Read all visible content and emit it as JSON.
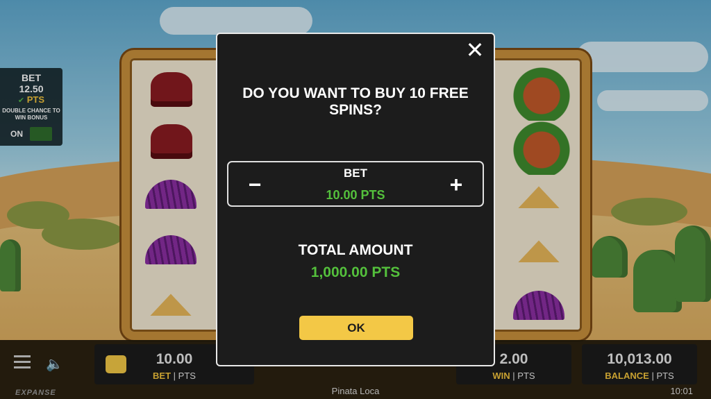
{
  "side_panel": {
    "bet_label": "BET",
    "bet_value": "12.50",
    "bet_unit": "PTS",
    "double_chance": "DOUBLE CHANCE TO WIN BONUS",
    "toggle_label": "ON"
  },
  "bottom_bar": {
    "bet_value": "10.00",
    "bet_label": "BET",
    "bet_unit": "PTS",
    "win_value": "2.00",
    "win_label": "WIN",
    "win_unit": "PTS",
    "balance_value": "10,013.00",
    "balance_label": "BALANCE",
    "balance_unit": "PTS",
    "game_name": "Pinata Loca",
    "clock": "10:01",
    "brand": "EXPANSE"
  },
  "modal": {
    "close_glyph": "✕",
    "question": "DO YOU WANT TO BUY 10 FREE SPINS?",
    "bet_label": "BET",
    "bet_value": "10.00 PTS",
    "minus_glyph": "−",
    "plus_glyph": "+",
    "total_label": "TOTAL AMOUNT",
    "total_value": "1,000.00 PTS",
    "ok_label": "OK"
  }
}
